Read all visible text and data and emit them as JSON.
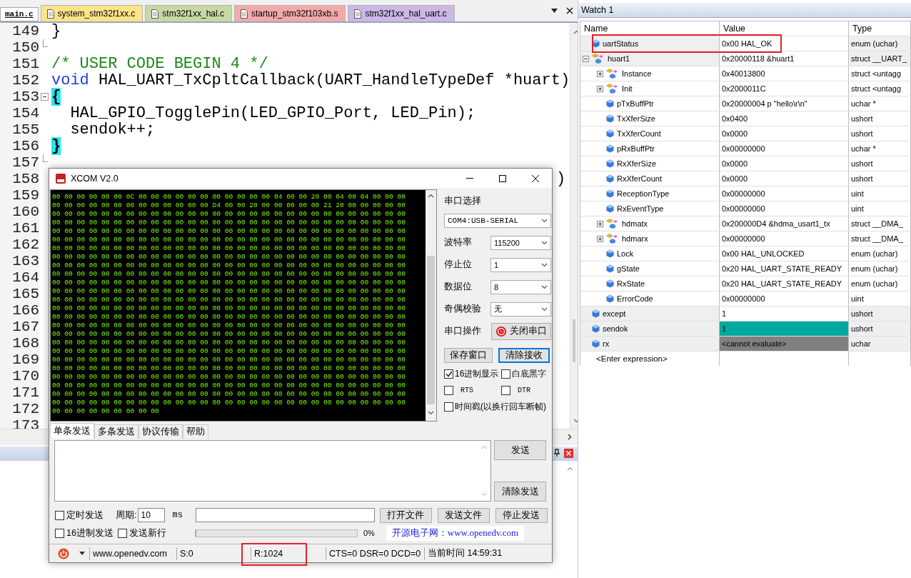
{
  "editor": {
    "tabs": [
      {
        "label": "main.c",
        "color": "#ffffff",
        "selected": true
      },
      {
        "label": "system_stm32f1xx.c",
        "color": "#fde38a",
        "selected": false
      },
      {
        "label": "stm32f1xx_hal.c",
        "color": "#c8d8a4",
        "selected": false
      },
      {
        "label": "startup_stm32f103xb.s",
        "color": "#f2a9a9",
        "selected": false
      },
      {
        "label": "stm32f1xx_hal_uart.c",
        "color": "#cbb8e6",
        "selected": false
      }
    ],
    "lines": [
      {
        "number": "149",
        "kind": "code",
        "segments": [
          {
            "kind": "plain",
            "text": "}"
          }
        ]
      },
      {
        "number": "150",
        "kind": "fold_end"
      },
      {
        "number": "151",
        "kind": "code",
        "segments": [
          {
            "kind": "comment",
            "text": "/* USER CODE BEGIN 4 */"
          }
        ]
      },
      {
        "number": "152",
        "kind": "code",
        "segments": [
          {
            "kind": "keyword",
            "text": "void"
          },
          {
            "kind": "plain",
            "text": " HAL_UART_TxCpltCallback(UART_HandleTypeDef *huart)"
          }
        ]
      },
      {
        "number": "153",
        "kind": "fold_start",
        "segments": [
          {
            "kind": "brace",
            "text": "{"
          }
        ]
      },
      {
        "number": "154",
        "kind": "code",
        "segments": [
          {
            "kind": "plain",
            "text": "  HAL_GPIO_TogglePin(LED_GPIO_Port, LED_Pin);"
          }
        ]
      },
      {
        "number": "155",
        "kind": "code",
        "segments": [
          {
            "kind": "plain",
            "text": "  sendok++;"
          }
        ]
      },
      {
        "number": "156",
        "kind": "code",
        "segments": [
          {
            "kind": "brace",
            "text": "}"
          }
        ]
      },
      {
        "number": "157",
        "kind": "fold_end"
      },
      {
        "number": "158",
        "kind": "tail",
        "segments": [
          {
            "kind": "plain",
            "text": ")"
          }
        ]
      },
      {
        "number": "159",
        "kind": "code"
      },
      {
        "number": "160",
        "kind": "code"
      },
      {
        "number": "161",
        "kind": "code"
      },
      {
        "number": "162",
        "kind": "code"
      },
      {
        "number": "163",
        "kind": "code"
      },
      {
        "number": "164",
        "kind": "code"
      },
      {
        "number": "165",
        "kind": "code"
      },
      {
        "number": "166",
        "kind": "code"
      },
      {
        "number": "167",
        "kind": "code"
      },
      {
        "number": "168",
        "kind": "code"
      },
      {
        "number": "169",
        "kind": "code"
      },
      {
        "number": "170",
        "kind": "code"
      },
      {
        "number": "171",
        "kind": "code"
      },
      {
        "number": "172",
        "kind": "code"
      },
      {
        "number": "173",
        "kind": "code"
      }
    ]
  },
  "watch": {
    "title": "Watch 1",
    "columns": [
      "Name",
      "Value",
      "Type"
    ],
    "rows": [
      {
        "name": "uartStatus",
        "value": "0x00 HAL_OK",
        "type": "enum (uchar)",
        "kind": "var",
        "changed": false,
        "unavailable": false,
        "highlighted": true
      },
      {
        "name": "huart1",
        "value": "0x20000118 &huart1",
        "type": "struct __UART_",
        "kind": "struct",
        "expanded": true,
        "changed": false,
        "unavailable": false,
        "highlighted": false,
        "children": [
          {
            "name": "Instance",
            "value": "0x40013800",
            "type": "struct <untagg",
            "kind": "struct",
            "expanded": false,
            "changed": false,
            "unavailable": false,
            "highlighted": false
          },
          {
            "name": "Init",
            "value": "0x2000011C",
            "type": "struct <untagg",
            "kind": "struct",
            "expanded": false,
            "changed": false,
            "unavailable": false,
            "highlighted": false
          },
          {
            "name": "pTxBuffPtr",
            "value": "0x20000004 p \"hello\\r\\n\"",
            "type": "uchar *",
            "kind": "var",
            "changed": false,
            "unavailable": false,
            "highlighted": false
          },
          {
            "name": "TxXferSize",
            "value": "0x0400",
            "type": "ushort",
            "kind": "var",
            "changed": false,
            "unavailable": false,
            "highlighted": false
          },
          {
            "name": "TxXferCount",
            "value": "0x0000",
            "type": "ushort",
            "kind": "var",
            "changed": false,
            "unavailable": false,
            "highlighted": false
          },
          {
            "name": "pRxBuffPtr",
            "value": "0x00000000",
            "type": "uchar *",
            "kind": "var",
            "changed": false,
            "unavailable": false,
            "highlighted": false
          },
          {
            "name": "RxXferSize",
            "value": "0x0000",
            "type": "ushort",
            "kind": "var",
            "changed": false,
            "unavailable": false,
            "highlighted": false
          },
          {
            "name": "RxXferCount",
            "value": "0x0000",
            "type": "ushort",
            "kind": "var",
            "changed": false,
            "unavailable": false,
            "highlighted": false
          },
          {
            "name": "ReceptionType",
            "value": "0x00000000",
            "type": "uint",
            "kind": "var",
            "changed": false,
            "unavailable": false,
            "highlighted": false
          },
          {
            "name": "RxEventType",
            "value": "0x00000000",
            "type": "uint",
            "kind": "var",
            "changed": false,
            "unavailable": false,
            "highlighted": false
          },
          {
            "name": "hdmatx",
            "value": "0x200000D4 &hdma_usart1_tx",
            "type": "struct __DMA_",
            "kind": "struct",
            "expanded": false,
            "changed": false,
            "unavailable": false,
            "highlighted": false
          },
          {
            "name": "hdmarx",
            "value": "0x00000000",
            "type": "struct __DMA_",
            "kind": "struct",
            "expanded": false,
            "changed": false,
            "unavailable": false,
            "highlighted": false
          },
          {
            "name": "Lock",
            "value": "0x00 HAL_UNLOCKED",
            "type": "enum (uchar)",
            "kind": "var",
            "changed": false,
            "unavailable": false,
            "highlighted": false
          },
          {
            "name": "gState",
            "value": "0x20 HAL_UART_STATE_READY",
            "type": "enum (uchar)",
            "kind": "var",
            "changed": false,
            "unavailable": false,
            "highlighted": false
          },
          {
            "name": "RxState",
            "value": "0x20 HAL_UART_STATE_READY",
            "type": "enum (uchar)",
            "kind": "var",
            "changed": false,
            "unavailable": false,
            "highlighted": false
          },
          {
            "name": "ErrorCode",
            "value": "0x00000000",
            "type": "uint",
            "kind": "var",
            "changed": false,
            "unavailable": false,
            "highlighted": false
          }
        ]
      },
      {
        "name": "except",
        "value": "1",
        "type": "ushort",
        "kind": "var",
        "changed": false,
        "unavailable": false,
        "highlighted": false
      },
      {
        "name": "sendok",
        "value": "1",
        "type": "ushort",
        "kind": "var",
        "changed": true,
        "unavailable": false,
        "highlighted": false
      },
      {
        "name": "rx",
        "value": "<cannot evaluate>",
        "type": "uchar",
        "kind": "var",
        "changed": false,
        "unavailable": true,
        "highlighted": false
      }
    ],
    "placeholder": "<Enter expression>"
  },
  "xcom": {
    "title": "XCOM V2.0",
    "hex_lines": [
      "00 00 00 00 00 00 0C 00 00 00 00 00 00 00 00 00 00 00 04 00 00 20 00 04 00 04 00 00 00",
      "00 00 00 00 00 00 00 00 00 00 00 00 00 D4 00 00 20 00 00 00 00 00 21 20 00 00 00 00 00",
      "00 00 00 00 00 00 00 00 00 00 00 00 00 00 00 00 00 00 00 00 00 00 00 00 00 00 00 00 00",
      "00 00 00 00 00 00 00 00 00 00 00 00 00 00 00 00 00 00 00 00 00 00 00 00 00 00 00 00 00",
      "00 00 00 00 00 00 00 00 00 00 00 00 00 00 00 00 00 00 00 00 00 00 00 00 00 00 00 00 00",
      "00 00 00 00 00 00 00 00 00 00 00 00 00 00 00 00 00 00 00 00 00 00 00 00 00 00 00 00 00",
      "00 00 00 00 00 00 00 00 00 00 00 00 00 00 00 00 00 00 00 00 00 00 00 00 00 00 00 00 00",
      "00 00 00 00 00 00 00 00 00 00 00 00 00 00 00 00 00 00 00 00 00 00 00 00 00 00 00 00 00",
      "00 00 00 00 00 00 00 00 00 00 00 00 00 00 00 00 00 00 00 00 00 00 00 00 00 00 00 00 00",
      "00 00 00 00 00 00 00 00 00 00 00 00 00 00 00 00 00 00 00 00 00 00 00 00 00 00 00 00 00",
      "00 00 00 00 00 00 00 00 00 00 00 00 00 00 00 00 00 00 00 00 00 00 00 00 00 00 00 00 00",
      "00 00 00 00 00 00 00 00 00 00 00 00 00 00 00 00 00 00 00 00 00 00 00 00 00 00 00 00 00",
      "00 00 00 00 00 00 00 00 00 00 00 00 00 00 00 00 00 00 00 00 00 00 00 00 00 00 00 00 00",
      "00 00 00 00 00 00 00 00 00 00 00 00 00 00 00 00 00 00 00 00 00 00 00 00 00 00 00 00 00",
      "00 00 00 00 00 00 00 00 00 00 00 00 00 00 00 00 00 00 00 00 00 00 00 00 00 00 00 00 00",
      "00 00 00 00 00 00 00 00 00 00 00 00 00 00 00 00 00 00 00 00 00 00 00 00 00 00 00 00 00",
      "00 00 00 00 00 00 00 00 00 00 00 00 00 00 00 00 00 00 00 00 00 00 00 00 00 00 00 00 00",
      "00 00 00 00 00 00 00 00 00 00 00 00 00 00 00 00 00 00 00 00 00 00 00 00 00 00 00 00 00",
      "00 00 00 00 00 00 00 00 00 00 00 00 00 00 00 00 00 00 00 00 00 00 00 00 00 00 00 00 00",
      "00 00 00 00 00 00 00 00 00 00 00 00 00 00 00 00 00 00 00 00 00 00 00 00 00 00 00 00 00",
      "00 00 00 00 00 00 00 00 00 00 00 00 00 00 00 00 00 00 00 00 00 00 00 00 00 00 00 00 00",
      "00 00 00 00 00 00 00 00 00 00 00 00 00 00 00 00 00 00 00 00 00 00 00 00 00 00 00 00 00",
      "00 00 00 00 00 00 00 00 00 00 00 00 00 00 00 00 00 00 00 00 00 00 00 00 00 00 00 00 00",
      "00 00 00 00 00 00 00 00 00 00 00 00 00 00 00 00 00 00 00 00 00 00 00 00 00 00 00 00 00",
      "00 00 00 00 00 00 00 00 00 00 00 00 00 00 00 00 00 00 00 00 00 00 00 00 00 00 00 00 00",
      "00 00 00 00 00 00 00 00 00"
    ],
    "port_label": "串口选择",
    "port": "COM4:USB-SERIAL",
    "settings": [
      {
        "label": "波特率",
        "value": "115200"
      },
      {
        "label": "停止位",
        "value": "1"
      },
      {
        "label": "数据位",
        "value": "8"
      },
      {
        "label": "奇偶校验",
        "value": "无"
      }
    ],
    "port_op": {
      "label": "串口操作",
      "button": "关闭串口",
      "open": true
    },
    "buttons": [
      {
        "label": "保存窗口",
        "focused": false
      },
      {
        "label": "清除接收",
        "focused": true
      }
    ],
    "options": [
      {
        "label": "16进制显示",
        "checked": true,
        "kind": "normal"
      },
      {
        "label": "白底黑字",
        "checked": false,
        "kind": "normal"
      },
      {
        "label": "RTS",
        "checked": false,
        "kind": "mono"
      },
      {
        "label": "DTR",
        "checked": false,
        "kind": "mono"
      },
      {
        "label": "时间戳(以换行回车断帧)",
        "checked": false,
        "kind": "wide"
      }
    ],
    "tabs": [
      {
        "label": "单条发送",
        "selected": true
      },
      {
        "label": "多条发送",
        "selected": false
      },
      {
        "label": "协议传输",
        "selected": false
      },
      {
        "label": "帮助",
        "selected": false
      }
    ],
    "send_buttons": [
      "发送",
      "清除发送"
    ],
    "timed": {
      "label": "定时发送",
      "checked": false
    },
    "period_label": "周期:",
    "period": "10",
    "period_unit": "ms",
    "file_buttons": [
      "打开文件",
      "发送文件",
      "停止发送"
    ],
    "hex_send": {
      "label": "16进制发送",
      "checked": false
    },
    "newline": {
      "label": "发送新行",
      "checked": false
    },
    "progress": {
      "level": 0,
      "reading": "0%"
    },
    "banner": "开源电子网：www.openedv.com",
    "status": [
      {
        "text": "www.openedv.com",
        "highlighted": false
      },
      {
        "text": "S:0",
        "highlighted": false
      },
      {
        "text": "R:1024",
        "highlighted": true
      },
      {
        "text": "CTS=0 DSR=0 DCD=0",
        "highlighted": false
      },
      {
        "text": "当前时间 14:59:31",
        "highlighted": false
      }
    ]
  }
}
